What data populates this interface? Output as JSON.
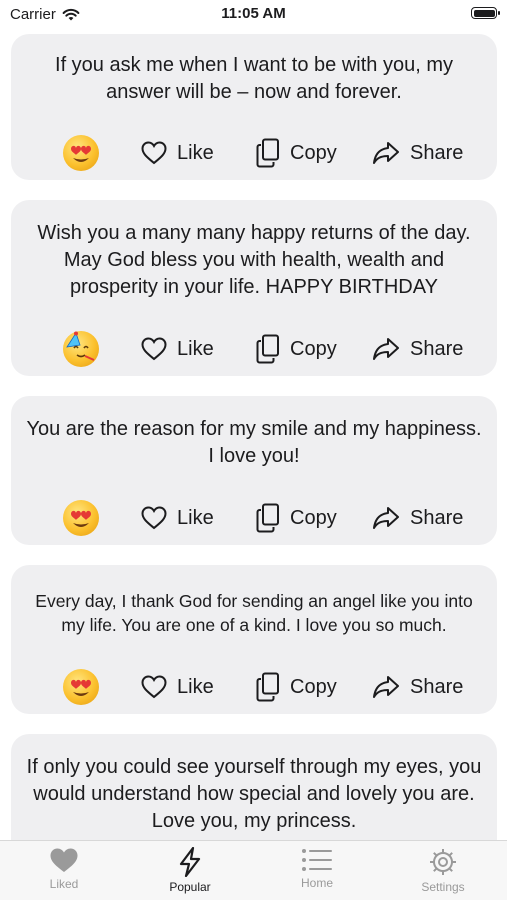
{
  "status": {
    "carrier": "Carrier",
    "time": "11:05 AM"
  },
  "cards": [
    {
      "quote": "If you ask me when I want to be with you, my answer will be – now and forever.",
      "emoji": "heart-eyes-emoji",
      "like": "Like",
      "copy": "Copy",
      "share": "Share"
    },
    {
      "quote": "Wish you a many many happy returns of the day. May God bless you with health, wealth and prosperity in your life. HAPPY BIRTHDAY",
      "emoji": "party-face-emoji",
      "like": "Like",
      "copy": "Copy",
      "share": "Share"
    },
    {
      "quote": "You are the reason for my smile and my happiness. I love you!",
      "emoji": "heart-eyes-emoji",
      "like": "Like",
      "copy": "Copy",
      "share": "Share"
    },
    {
      "quote": "Every day, I thank God for sending an angel like you into my life. You are one of a kind. I love you so much.",
      "emoji": "heart-eyes-emoji",
      "like": "Like",
      "copy": "Copy",
      "share": "Share"
    },
    {
      "quote": "If only you could see yourself through my eyes, you would understand how special and lovely you are. Love you, my princess."
    }
  ],
  "tabs": [
    {
      "label": "Liked",
      "icon": "heart-icon",
      "active": false
    },
    {
      "label": "Popular",
      "icon": "bolt-icon",
      "active": true
    },
    {
      "label": "Home",
      "icon": "list-icon",
      "active": false
    },
    {
      "label": "Settings",
      "icon": "gear-icon",
      "active": false
    }
  ],
  "colors": {
    "card_bg": "#efeff1",
    "tab_inactive": "#9a9a9a",
    "tab_active": "#1c1c1e"
  }
}
